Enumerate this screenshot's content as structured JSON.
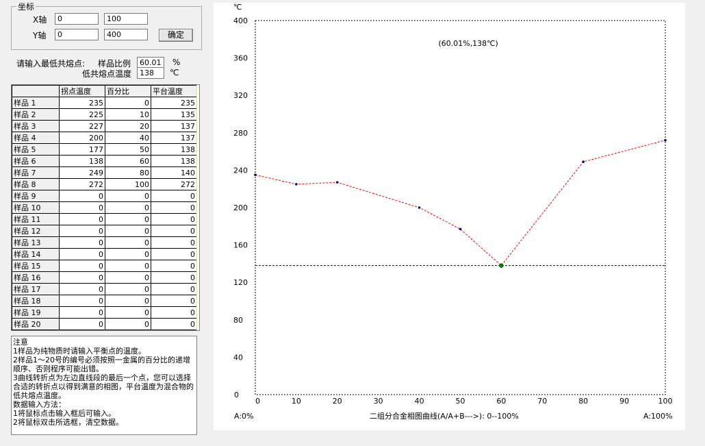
{
  "coords": {
    "group_title": "坐标",
    "x_label": "X轴",
    "x_min": "0",
    "x_max": "100",
    "y_label": "Y轴",
    "y_min": "0",
    "y_max": "400",
    "ok_button": "确定"
  },
  "eutectic": {
    "prompt": "请输入最低共熔点:",
    "ratio_label": "样品比例",
    "ratio_value": "60.01",
    "ratio_unit": "%",
    "temp_label": "低共熔点温度",
    "temp_value": "138",
    "temp_unit": "℃"
  },
  "grid": {
    "headers": [
      "",
      "拐点温度",
      "百分比",
      "平台温度"
    ],
    "rows": [
      [
        "样品 1",
        "235",
        "0",
        "235"
      ],
      [
        "样品 2",
        "225",
        "10",
        "135"
      ],
      [
        "样品 3",
        "227",
        "20",
        "137"
      ],
      [
        "样品 4",
        "200",
        "40",
        "137"
      ],
      [
        "样品 5",
        "177",
        "50",
        "138"
      ],
      [
        "样品 6",
        "138",
        "60",
        "138"
      ],
      [
        "样品 7",
        "249",
        "80",
        "140"
      ],
      [
        "样品 8",
        "272",
        "100",
        "272"
      ],
      [
        "样品 9",
        "0",
        "0",
        "0"
      ],
      [
        "样品 10",
        "0",
        "0",
        "0"
      ],
      [
        "样品 11",
        "0",
        "0",
        "0"
      ],
      [
        "样品 12",
        "0",
        "0",
        "0"
      ],
      [
        "样品 13",
        "0",
        "0",
        "0"
      ],
      [
        "样品 14",
        "0",
        "0",
        "0"
      ],
      [
        "样品 15",
        "0",
        "0",
        "0"
      ],
      [
        "样品 16",
        "0",
        "0",
        "0"
      ],
      [
        "样品 17",
        "0",
        "0",
        "0"
      ],
      [
        "样品 18",
        "0",
        "0",
        "0"
      ],
      [
        "样品 19",
        "0",
        "0",
        "0"
      ],
      [
        "样品 20",
        "0",
        "0",
        "0"
      ]
    ]
  },
  "notes": {
    "lines": [
      "注意",
      "1样品为纯物质时请输入平衡点的温度。",
      "2样品1～20号的编号必须按照一金属的百分比的递增顺序、否则程序可能出错。",
      "3曲线转折点为左边直线段的最后一个点，您可以选择合适的转折点以得到满意的相图，平台温度为混合物的低共熔点温度。",
      "数据输入方法：",
      "1将鼠标点击输入框后可输入。",
      "2将鼠标双击所选框，清空数据。"
    ]
  },
  "chart_data": {
    "type": "line",
    "y_unit": "℃",
    "x": [
      0,
      10,
      20,
      40,
      50,
      60,
      80,
      100
    ],
    "y": [
      235,
      225,
      227,
      200,
      177,
      138,
      249,
      272
    ],
    "xlim": [
      0,
      100
    ],
    "ylim": [
      0,
      400
    ],
    "x_ticks": [
      0,
      10,
      20,
      30,
      40,
      50,
      60,
      70,
      80,
      90,
      100
    ],
    "y_ticks": [
      0,
      40,
      80,
      120,
      160,
      200,
      240,
      280,
      320,
      360,
      400
    ],
    "eutectic_point": {
      "x": 60.01,
      "y": 138
    },
    "annotation": "(60.01%,138℃)",
    "left_label": "A:0%",
    "xlabel": "二组分合金相图曲线(A/A+B--->): 0--100%",
    "right_label": "A:100%",
    "grid": false,
    "line_color": "#ff0000",
    "marker_color": "#000080",
    "eutectic_marker_color": "#008000"
  }
}
